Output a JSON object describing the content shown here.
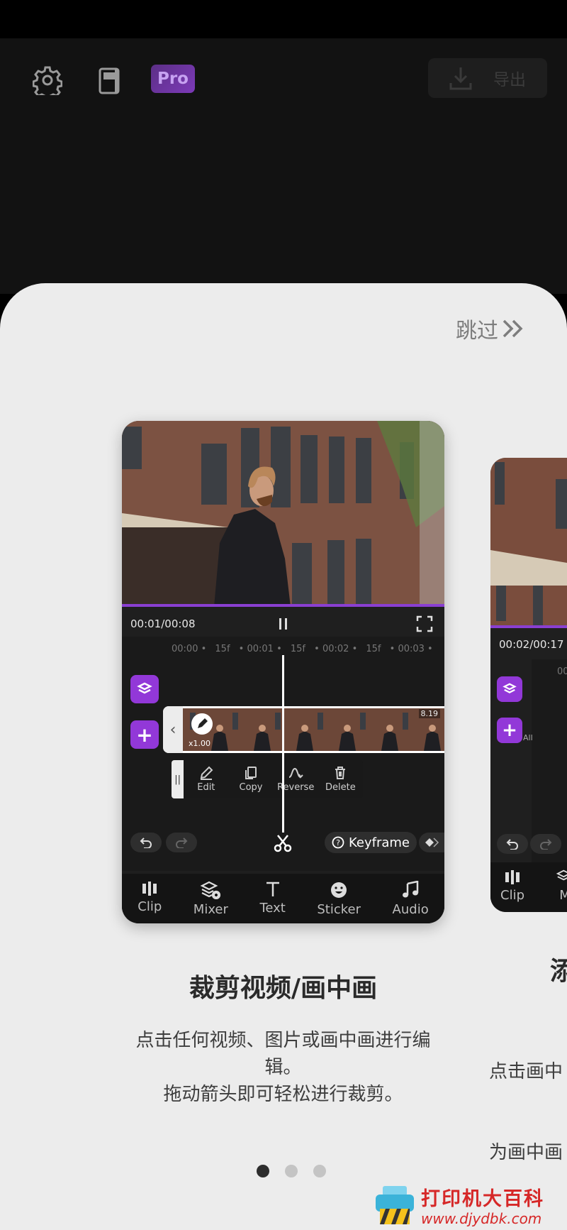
{
  "toolbar": {
    "settings_icon": "gear-icon",
    "drafts_icon": "document-icon",
    "pro_label": "Pro",
    "export_label": "导出",
    "export_icon": "download-icon"
  },
  "onboarding": {
    "skip_label": "跳过",
    "skip_icon": "double-chevron-right-icon",
    "page_index": 0,
    "page_count": 3,
    "cards": [
      {
        "title": "裁剪视频/画中画",
        "description_line1": "点击任何视频、图片或画中画进行编",
        "description_line2": "辑。",
        "description_line3": "拖动箭头即可轻松进行裁剪。",
        "preview": {
          "time": "00:01/00:08",
          "ruler": [
            "00:00",
            "15f",
            "00:01",
            "15f",
            "00:02",
            "15f",
            "00:03"
          ],
          "clip_speed": "x1.00",
          "clip_duration": "8.19",
          "actions": [
            "Edit",
            "Copy",
            "Reverse",
            "Delete"
          ],
          "keyframe_label": "Keyframe",
          "nav": [
            "Clip",
            "Mixer",
            "Text",
            "Sticker",
            "Audio"
          ]
        }
      },
      {
        "title_partial": "添",
        "description_line1": "点击画中",
        "description_line2": "为画中画",
        "preview": {
          "time": "00:02/00:17",
          "ruler_partial": "00:",
          "all_label": "All",
          "nav": [
            "Clip",
            "M"
          ]
        }
      }
    ]
  },
  "watermark": {
    "text": "打印机大百科",
    "url": "www.djydbk.com"
  },
  "colors": {
    "accent": "#9238d8",
    "sheet_background": "#ececec",
    "app_background": "#121212"
  }
}
